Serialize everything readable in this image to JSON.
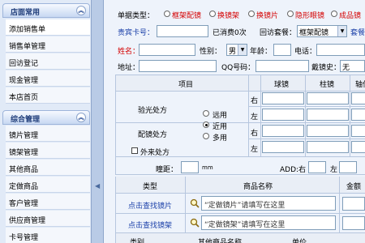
{
  "sidebar": {
    "sections": [
      {
        "title": "店面常用",
        "items": [
          "添加销售单",
          "销售单管理",
          "回访登记",
          "现金管理",
          "本店首页"
        ]
      },
      {
        "title": "综合管理",
        "items": [
          "镜片管理",
          "镜架管理",
          "其他商品",
          "定做商品",
          "客户管理",
          "供应商管理",
          "卡号管理"
        ]
      }
    ]
  },
  "form": {
    "order_type_label": "单据类型：",
    "order_types": [
      "框架配镜",
      "换镜架",
      "换镜片",
      "隐形眼镜",
      "成品镜"
    ],
    "vip_label": "贵宾卡号：",
    "consumed_label": "已消费0次",
    "return_visit_label": "回访套餐：",
    "return_visit_value": "框架配镜",
    "set_label": "套餐",
    "name_label": "姓名：",
    "gender_label": "性别：",
    "gender_value": "男",
    "age_label": "年龄：",
    "phone_label": "电话：",
    "address_label": "地址：",
    "qq_label": "QQ号码：",
    "glasses_history_label": "戴镜史：",
    "glasses_history_value": "无"
  },
  "rx": {
    "col_item": "项目",
    "col_sph": "球镜",
    "col_cyl": "柱镜",
    "col_axis": "轴位",
    "row_optometry": "验光处方",
    "row_fitting": "配镜处方",
    "row_external": "外来处方",
    "right": "右",
    "left": "左",
    "distance_options": [
      "远用",
      "近用",
      "多用"
    ],
    "pupil_label": "瞳距：",
    "mm": "mm",
    "add_label": "ADD:右",
    "add_left": "左"
  },
  "goods": {
    "col_type": "类型",
    "col_name": "商品名称",
    "col_amount": "金额",
    "pick_lens": "点击查找镜片",
    "pick_frame": "点击查找镜架",
    "lens_placeholder": "“定做镜片”请填写在这里",
    "frame_placeholder": "“定做镜架”请填写在这里"
  },
  "bottom_row": [
    "类别",
    "其他商品名称",
    "单价"
  ]
}
